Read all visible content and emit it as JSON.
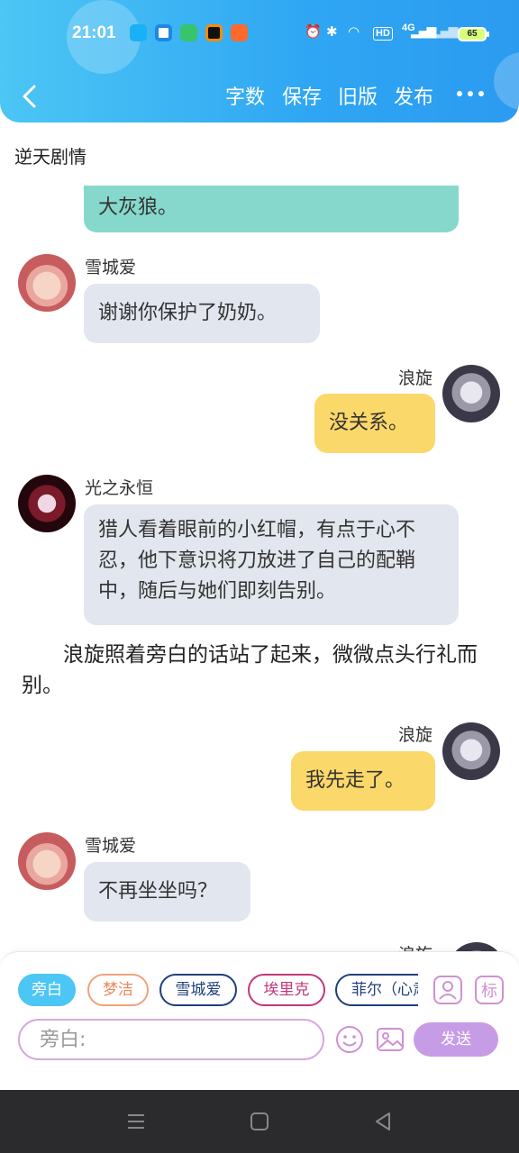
{
  "status_bar": {
    "time": "21:01",
    "signal_label": "4G",
    "hd_label": "HD",
    "battery": "65",
    "app_icons": [
      "qq-icon",
      "browser-icon",
      "wechat-mini-icon",
      "app-icon",
      "shop-icon"
    ]
  },
  "header": {
    "buttons": {
      "word_count": "字数",
      "save": "保存",
      "old_version": "旧版",
      "publish": "发布"
    },
    "colors": {
      "gradient_start": "#4cc6f4",
      "gradient_end": "#2b9bf0"
    }
  },
  "story": {
    "title": "逆天剧情"
  },
  "messages": [
    {
      "type": "partial",
      "text": "大灰狼。"
    },
    {
      "type": "left",
      "speaker": "雪城爱",
      "text": "谢谢你保护了奶奶。"
    },
    {
      "type": "right",
      "speaker": "浪旋",
      "text": "没关系。"
    },
    {
      "type": "left",
      "speaker": "光之永恒",
      "text": "猎人看着眼前的小红帽，有点于心不忍，他下意识将刀放进了自己的配鞘中，随后与她们即刻告别。"
    },
    {
      "type": "narration",
      "text": "浪旋照着旁白的话站了起来，微微点头行礼而别。"
    },
    {
      "type": "right",
      "speaker": "浪旋",
      "text": "我先走了。"
    },
    {
      "type": "left",
      "speaker": "雪城爱",
      "text": "不再坐坐吗？"
    },
    {
      "type": "right",
      "speaker": "浪旋",
      "text": ""
    }
  ],
  "composer": {
    "characters": [
      {
        "label": "旁白",
        "color": "#4cc6f4",
        "active": true
      },
      {
        "label": "梦洁",
        "color": "#f0a27a",
        "active": false
      },
      {
        "label": "雪城爱",
        "color": "#1f3f7a",
        "active": false
      },
      {
        "label": "埃里克",
        "color": "#c0387a",
        "active": false
      },
      {
        "label": "菲尔（心肃",
        "color": "#1f3f7a",
        "active": false
      }
    ],
    "input_placeholder": "旁白:",
    "send_label": "发送"
  }
}
